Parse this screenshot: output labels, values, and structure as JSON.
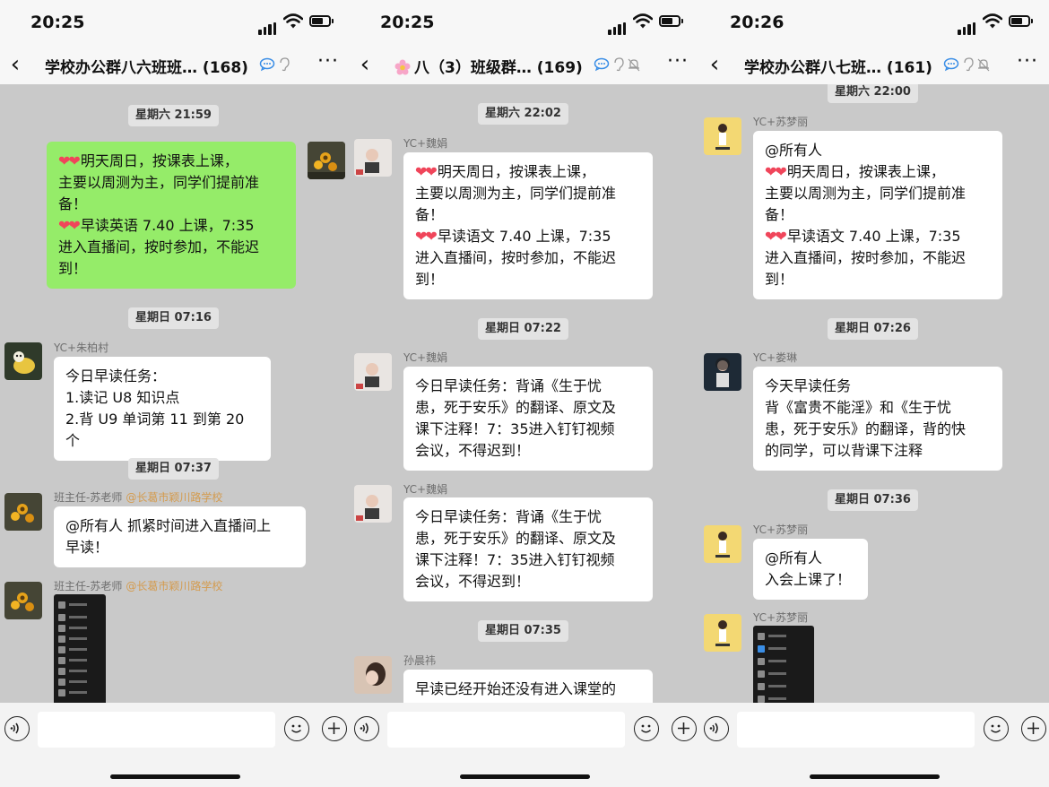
{
  "panels": [
    {
      "time": "20:25",
      "title": "学校办公群八六班班…",
      "count": "(168)",
      "timestamps": [
        "星期六 21:59",
        "星期日 07:16",
        "星期日 07:37"
      ],
      "messages": [
        {
          "sender": "",
          "lines": [
            "明天周日，按课表上课，",
            "主要以周测为主，同学们提前准",
            "备！",
            "早读英语 7.40 上课，7:35",
            "进入直播间，按时参加，不能迟",
            "到！"
          ]
        },
        {
          "sender": "YC+朱柏村",
          "lines": [
            "今日早读任务：",
            "1.读记 U8 知识点",
            "2.背 U9 单词第 11 到第 20 个"
          ]
        },
        {
          "sender": "班主任-苏老师",
          "org": "@长葛市颖川路学校",
          "lines": [
            "@所有人 抓紧时间进入直播间上",
            "早读！"
          ]
        },
        {
          "sender": "班主任-苏老师",
          "org": "@长葛市颖川路学校",
          "lines": []
        }
      ]
    },
    {
      "time": "20:25",
      "title": "八（3）班级群…",
      "count": "(169)",
      "timestamps": [
        "星期六 22:02",
        "星期日 07:22",
        "星期日 07:35"
      ],
      "messages": [
        {
          "sender": "YC+魏娟",
          "lines": [
            "明天周日，按课表上课，",
            "主要以周测为主，同学们提前准",
            "备！",
            "早读语文 7.40 上课，7:35",
            "进入直播间，按时参加，不能迟",
            "到！"
          ]
        },
        {
          "sender": "YC+魏娟",
          "lines": [
            "今日早读任务：背诵《生于忧",
            "患，死于安乐》的翻译、原文及",
            "课下注释！7：35进入钉钉视频",
            "会议，不得迟到！"
          ]
        },
        {
          "sender": "YC+魏娟",
          "lines": [
            "今日早读任务：背诵《生于忧",
            "患，死于安乐》的翻译、原文及",
            "课下注释！7：35进入钉钉视频",
            "会议，不得迟到！"
          ]
        },
        {
          "sender": "孙晨祎",
          "lines": [
            "早读已经开始还没有进入课堂的"
          ]
        }
      ]
    },
    {
      "time": "20:26",
      "title": "学校办公群八七班…",
      "count": "(161)",
      "timestamps": [
        "星期六 22:00",
        "星期日 07:26",
        "星期日 07:36"
      ],
      "messages": [
        {
          "sender": "YC+苏梦丽",
          "lines": [
            "@所有人",
            "明天周日，按课表上课，",
            "主要以周测为主，同学们提前准",
            "备！",
            "早读语文 7.40 上课，7:35",
            "进入直播间，按时参加，不能迟",
            "到！"
          ]
        },
        {
          "sender": "YC+娄琳",
          "lines": [
            "今天早读任务",
            "背《富贵不能淫》和《生于忧",
            "患，死于安乐》的翻译，背的快",
            "的同学，可以背课下注释"
          ]
        },
        {
          "sender": "YC+苏梦丽",
          "lines": [
            "@所有人",
            "入会上课了！"
          ]
        },
        {
          "sender": "YC+苏梦丽",
          "lines": []
        }
      ]
    }
  ],
  "colors": {
    "green_bubble": "#95ec69",
    "heart": "#f0455a",
    "org_tag": "#d49b4e"
  },
  "icons": [
    "back-icon",
    "chat-bubble-icon",
    "ear-icon",
    "mute-bell-icon",
    "more-icon",
    "voice-icon",
    "emoji-icon",
    "plus-icon"
  ]
}
